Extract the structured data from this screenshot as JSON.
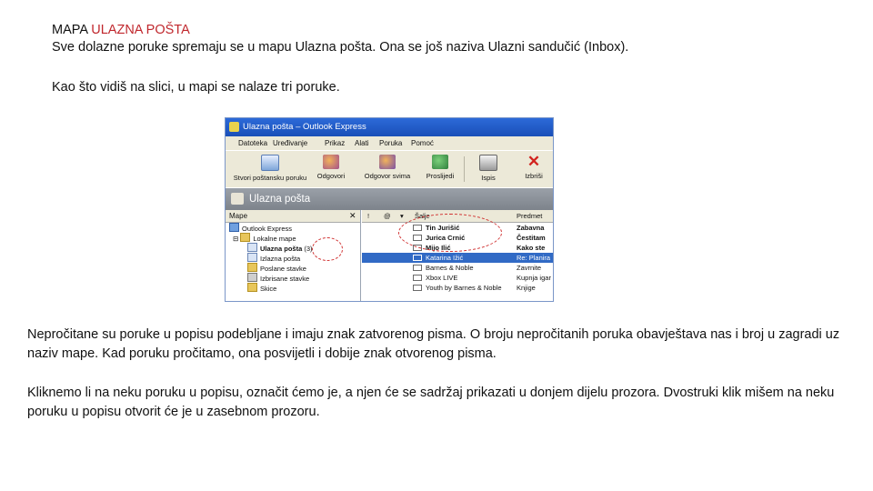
{
  "heading": {
    "prefix": "MAPA ",
    "highlight": "ULAZNA POŠTA"
  },
  "intro": "Sve dolazne poruke spremaju se u mapu Ulazna pošta. Ona se još naziva Ulazni sandučić (Inbox).",
  "intro2": "Kao što vidiš na slici, u mapi se nalaze tri poruke.",
  "screenshot": {
    "title": "Ulazna pošta – Outlook Express",
    "menu": [
      "Datoteka",
      "Uređivanje",
      "Prikaz",
      "Alati",
      "Poruka",
      "Pomoć"
    ],
    "toolbar": [
      "Stvori poštansku poruku",
      "Odgovori",
      "Odgovor svima",
      "Proslijedi",
      "Ispis",
      "Izbriši"
    ],
    "folder_title": "Ulazna pošta",
    "folders_header": "Mape",
    "folders": [
      "Outlook Express",
      "Lokalne mape",
      "Ulazna pošta",
      "(3)",
      "Izlazna pošta",
      "Poslane stavke",
      "Izbrisane stavke",
      "Skice"
    ],
    "columns": {
      "from": "Šalje",
      "subject": "Predmet"
    },
    "messages": [
      {
        "from": "Tin Jurišić",
        "subject": "Zabavna"
      },
      {
        "from": "Jurica Crnić",
        "subject": "Čestitam"
      },
      {
        "from": "Mijo Ilić",
        "subject": "Kako ste"
      },
      {
        "from": "Katarina Ižić",
        "subject": "Re: Planira"
      },
      {
        "from": "Barnes & Noble",
        "subject": "Zavrnite"
      },
      {
        "from": "Xbox LIVE",
        "subject": "Kupnja igar"
      },
      {
        "from": "Youth by Barnes & Noble",
        "subject": "Knjige"
      }
    ]
  },
  "para1": "Nepročitane su poruke u popisu podebljane i imaju znak zatvorenog pisma. O broju nepročitanih poruka obavještava nas i broj u zagradi uz naziv mape. Kad poruku pročitamo, ona posvijetli i dobije znak otvorenog pisma.",
  "para2": "Kliknemo li na neku poruku u popisu, označit ćemo je, a njen će se sadržaj prikazati u donjem dijelu prozora. Dvostruki klik mišem na neku poruku u popisu otvorit će je u zasebnom prozoru.",
  "colors": {
    "highlight": "#c0272d",
    "selection": "#316ac5",
    "titlebar": "#2c6ad8"
  }
}
